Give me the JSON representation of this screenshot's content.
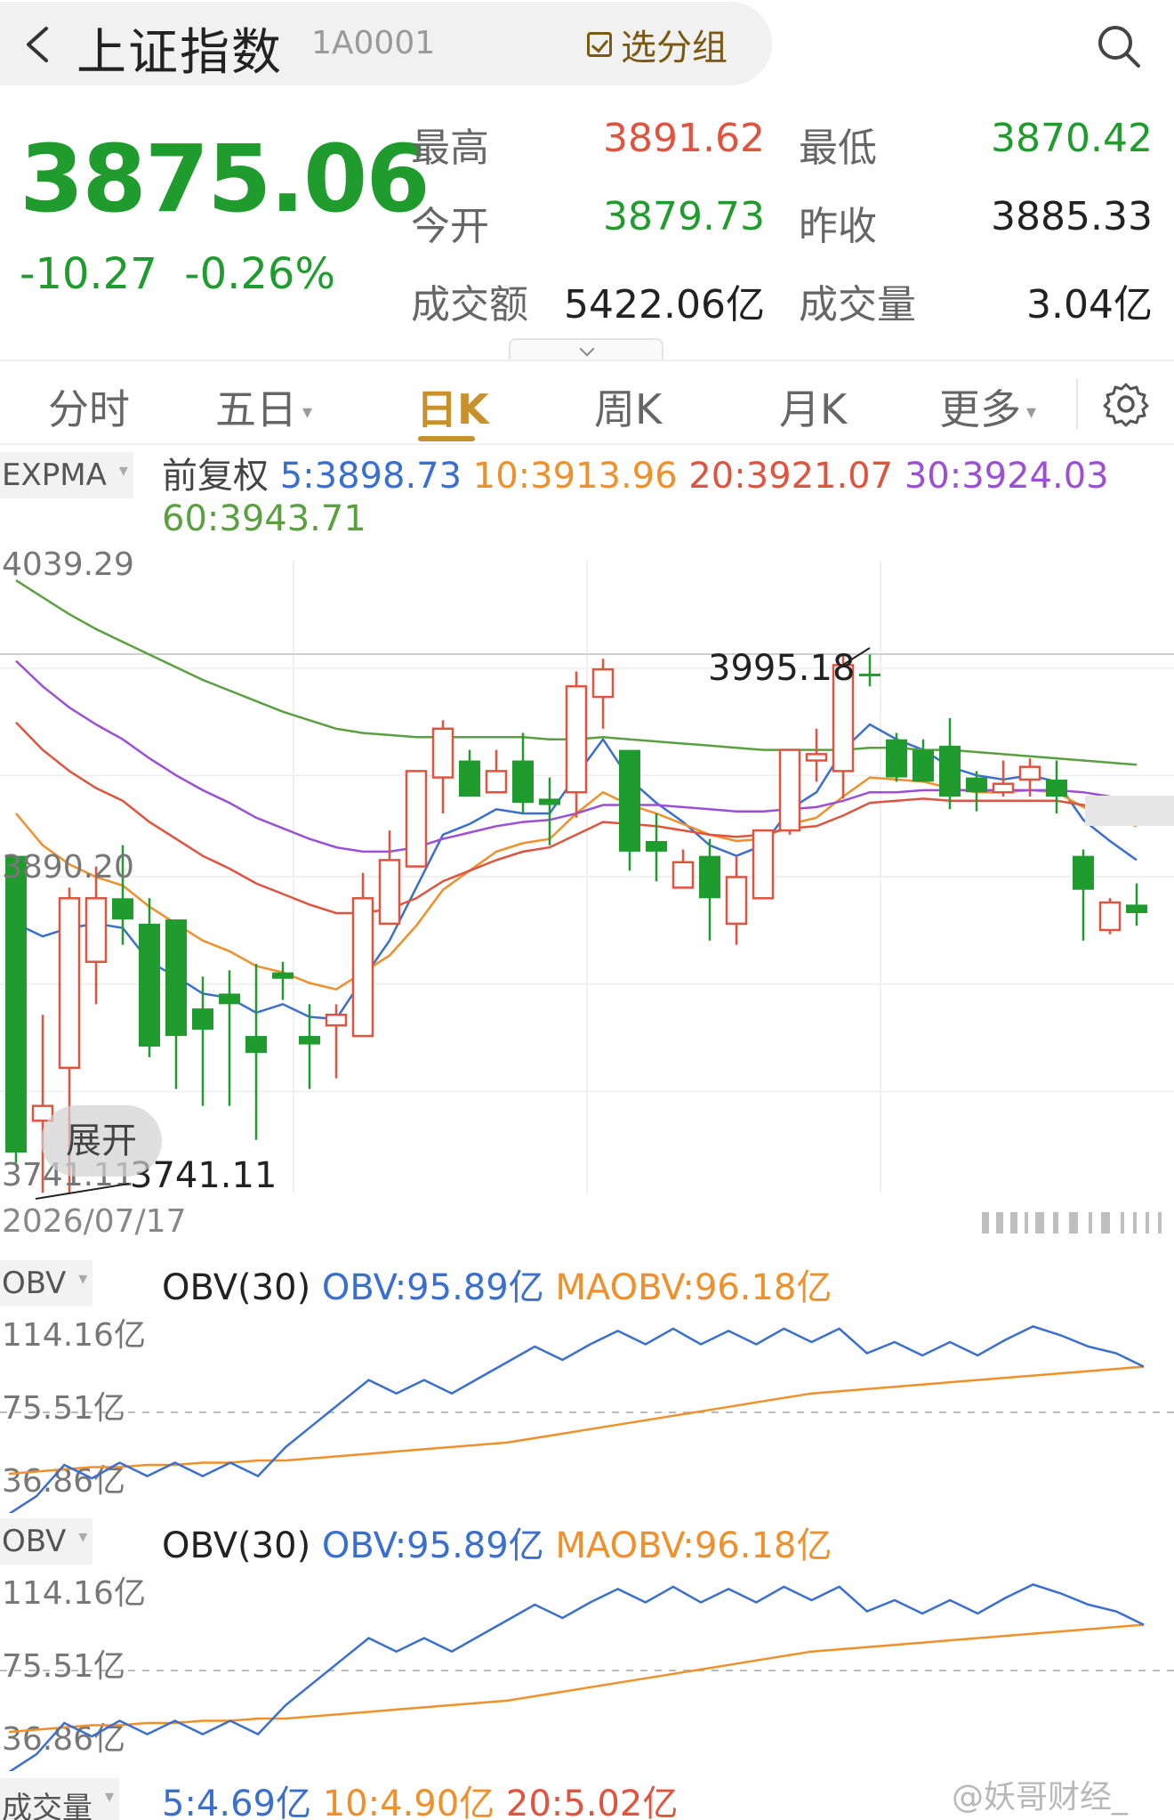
{
  "header": {
    "title": "上证指数",
    "code": "1A0001",
    "group_button": "选分组"
  },
  "quote": {
    "price": "3875.06",
    "change": "-10.27",
    "change_pct": "-0.26%",
    "stats": [
      {
        "label": "最高",
        "value": "3891.62",
        "color": "#e0533e"
      },
      {
        "label": "最低",
        "value": "3870.42",
        "color": "#1f9c2d"
      },
      {
        "label": "今开",
        "value": "3879.73",
        "color": "#1f9c2d"
      },
      {
        "label": "昨收",
        "value": "3885.33",
        "color": "#222222"
      },
      {
        "label": "成交额",
        "value": "5422.06亿",
        "color": "#222222"
      },
      {
        "label": "成交量",
        "value": "3.04亿",
        "color": "#222222"
      }
    ]
  },
  "tabs": [
    "分时",
    "五日",
    "日K",
    "周K",
    "月K",
    "更多"
  ],
  "active_tab": "日K",
  "kline": {
    "indicator": "EXPMA",
    "adjust": "前复权",
    "legend": [
      {
        "label": "5:3898.73",
        "color": "#3a6fd0"
      },
      {
        "label": "10:3913.96",
        "color": "#f0902a"
      },
      {
        "label": "20:3921.07",
        "color": "#e0533e"
      },
      {
        "label": "30:3924.03",
        "color": "#9b4fd6"
      },
      {
        "label": "60:3943.71",
        "color": "#5aa040"
      }
    ],
    "y_max_label": "4039.29",
    "y_mid_label": "3890.20",
    "y_min_label": "3741.11",
    "low_marker": "3741.11",
    "high_marker": "3995.18",
    "expand_label": "展开",
    "date": "2026/07/17"
  },
  "obv_panels": [
    {
      "indicator": "OBV",
      "params": "OBV(30)",
      "obv": "OBV:95.89亿",
      "maobv": "MAOBV:96.18亿",
      "y_labels": [
        "114.16亿",
        "75.51亿",
        "36.86亿"
      ]
    },
    {
      "indicator": "OBV",
      "params": "OBV(30)",
      "obv": "OBV:95.89亿",
      "maobv": "MAOBV:96.18亿",
      "y_labels": [
        "114.16亿",
        "75.51亿",
        "36.86亿"
      ]
    }
  ],
  "volume_row": {
    "indicator": "成交量",
    "ma5": "5:4.69亿",
    "ma10": "10:4.90亿",
    "ma20": "20:5.02亿"
  },
  "watermark": "@妖哥财经_",
  "colors": {
    "up": "#e0533e",
    "down": "#1f9c2d",
    "accent": "#c8912b",
    "obv": "#3a6fd0",
    "maobv": "#f0902a"
  },
  "chart_data": {
    "type": "candlestick",
    "ylim": [
      3741.11,
      4039.29
    ],
    "candles": [
      {
        "o": 3900,
        "h": 3900,
        "c": 3760,
        "l": 3755
      },
      {
        "o": 3775,
        "h": 3825,
        "c": 3782,
        "l": 3741
      },
      {
        "o": 3800,
        "h": 3885,
        "c": 3880,
        "l": 3741
      },
      {
        "o": 3850,
        "h": 3895,
        "c": 3880,
        "l": 3830
      },
      {
        "o": 3880,
        "h": 3905,
        "c": 3870,
        "l": 3858
      },
      {
        "o": 3868,
        "h": 3880,
        "c": 3810,
        "l": 3805
      },
      {
        "o": 3870,
        "h": 3870,
        "c": 3815,
        "l": 3790
      },
      {
        "o": 3828,
        "h": 3843,
        "c": 3818,
        "l": 3782
      },
      {
        "o": 3835,
        "h": 3846,
        "c": 3830,
        "l": 3782
      },
      {
        "o": 3815,
        "h": 3849,
        "c": 3807,
        "l": 3766
      },
      {
        "o": 3845,
        "h": 3850,
        "c": 3842,
        "l": 3832
      },
      {
        "o": 3815,
        "h": 3830,
        "c": 3811,
        "l": 3790
      },
      {
        "o": 3820,
        "h": 3830,
        "c": 3825,
        "l": 3795
      },
      {
        "o": 3815,
        "h": 3892,
        "c": 3880,
        "l": 3815
      },
      {
        "o": 3868,
        "h": 3912,
        "c": 3898,
        "l": 3868
      },
      {
        "o": 3895,
        "h": 3940,
        "c": 3940,
        "l": 3895
      },
      {
        "o": 3937,
        "h": 3964,
        "c": 3960,
        "l": 3920
      },
      {
        "o": 3945,
        "h": 3950,
        "c": 3928,
        "l": 3928
      },
      {
        "o": 3930,
        "h": 3950,
        "c": 3940,
        "l": 3930
      },
      {
        "o": 3945,
        "h": 3958,
        "c": 3925,
        "l": 3920
      },
      {
        "o": 3927,
        "h": 3937,
        "c": 3924,
        "l": 3905
      },
      {
        "o": 3930,
        "h": 3987,
        "c": 3980,
        "l": 3918
      },
      {
        "o": 3975,
        "h": 3993,
        "c": 3988,
        "l": 3960
      },
      {
        "o": 3950,
        "h": 3950,
        "c": 3902,
        "l": 3893
      },
      {
        "o": 3907,
        "h": 3920,
        "c": 3902,
        "l": 3888
      },
      {
        "o": 3885,
        "h": 3903,
        "c": 3897,
        "l": 3885
      },
      {
        "o": 3900,
        "h": 3908,
        "c": 3880,
        "l": 3860
      },
      {
        "o": 3868,
        "h": 3900,
        "c": 3890,
        "l": 3858
      },
      {
        "o": 3880,
        "h": 3910,
        "c": 3912,
        "l": 3880
      },
      {
        "o": 3912,
        "h": 3950,
        "c": 3950,
        "l": 3910
      },
      {
        "o": 3945,
        "h": 3960,
        "c": 3948,
        "l": 3935
      },
      {
        "o": 3940,
        "h": 3995,
        "c": 3990,
        "l": 3927
      },
      {
        "o": 3986,
        "h": 3995,
        "c": 3985,
        "l": 3980
      },
      {
        "o": 3955,
        "h": 3958,
        "c": 3937,
        "l": 3935
      },
      {
        "o": 3950,
        "h": 3955,
        "c": 3935,
        "l": 3935
      },
      {
        "o": 3952,
        "h": 3965,
        "c": 3928,
        "l": 3922
      },
      {
        "o": 3937,
        "h": 3940,
        "c": 3930,
        "l": 3921
      },
      {
        "o": 3930,
        "h": 3945,
        "c": 3934,
        "l": 3928
      },
      {
        "o": 3936,
        "h": 3946,
        "c": 3942,
        "l": 3928
      },
      {
        "o": 3936,
        "h": 3945,
        "c": 3928,
        "l": 3920
      },
      {
        "o": 3900,
        "h": 3903,
        "c": 3884,
        "l": 3860
      },
      {
        "o": 3865,
        "h": 3880,
        "c": 3878,
        "l": 3863
      },
      {
        "o": 3877,
        "h": 3887,
        "c": 3873,
        "l": 3867
      }
    ],
    "series": [
      {
        "name": "5",
        "values": [
          3868,
          3862,
          3866,
          3868,
          3866,
          3850,
          3843,
          3835,
          3833,
          3826,
          3830,
          3824,
          3823,
          3842,
          3860,
          3885,
          3910,
          3915,
          3922,
          3920,
          3920,
          3938,
          3955,
          3936,
          3925,
          3916,
          3905,
          3900,
          3905,
          3922,
          3930,
          3950,
          3962,
          3955,
          3950,
          3942,
          3938,
          3936,
          3938,
          3935,
          3917,
          3907,
          3898
        ]
      },
      {
        "name": "10",
        "values": [
          3920,
          3905,
          3896,
          3890,
          3886,
          3876,
          3868,
          3860,
          3855,
          3848,
          3845,
          3840,
          3837,
          3845,
          3853,
          3867,
          3884,
          3893,
          3902,
          3906,
          3908,
          3920,
          3930,
          3924,
          3920,
          3915,
          3910,
          3907,
          3908,
          3915,
          3918,
          3928,
          3937,
          3936,
          3935,
          3932,
          3930,
          3930,
          3931,
          3930,
          3923,
          3918,
          3914
        ]
      },
      {
        "name": "20",
        "values": [
          3963,
          3950,
          3940,
          3932,
          3926,
          3916,
          3908,
          3900,
          3894,
          3887,
          3882,
          3877,
          3873,
          3873,
          3875,
          3880,
          3888,
          3893,
          3898,
          3902,
          3904,
          3910,
          3916,
          3915,
          3914,
          3912,
          3910,
          3909,
          3910,
          3913,
          3914,
          3919,
          3925,
          3926,
          3927,
          3926,
          3926,
          3926,
          3926,
          3926,
          3924,
          3922,
          3921
        ]
      },
      {
        "name": "30",
        "values": [
          3992,
          3980,
          3970,
          3962,
          3955,
          3946,
          3938,
          3931,
          3925,
          3918,
          3913,
          3908,
          3904,
          3902,
          3902,
          3904,
          3908,
          3911,
          3914,
          3916,
          3917,
          3920,
          3924,
          3924,
          3924,
          3923,
          3922,
          3921,
          3921,
          3922,
          3923,
          3926,
          3930,
          3930,
          3931,
          3931,
          3931,
          3931,
          3931,
          3931,
          3930,
          3928,
          3924
        ]
      },
      {
        "name": "60",
        "values": [
          4030,
          4022,
          4014,
          4007,
          4001,
          3995,
          3989,
          3983,
          3978,
          3973,
          3968,
          3964,
          3960,
          3958,
          3957,
          3956,
          3956,
          3956,
          3956,
          3956,
          3955,
          3955,
          3956,
          3955,
          3954,
          3953,
          3952,
          3951,
          3950,
          3950,
          3950,
          3950,
          3951,
          3951,
          3950,
          3950,
          3949,
          3948,
          3947,
          3946,
          3945,
          3944,
          3943
        ]
      }
    ],
    "obv": {
      "ylim": [
        36.86,
        114.16
      ],
      "obv": [
        30,
        38,
        52,
        46,
        53,
        47,
        53,
        47,
        53,
        47,
        60,
        70,
        80,
        90,
        84,
        90,
        84,
        91,
        98,
        105,
        99,
        106,
        112,
        106,
        113,
        106,
        112,
        106,
        113,
        107,
        113,
        102,
        107,
        101,
        107,
        101,
        108,
        114,
        110,
        105,
        102,
        96
      ],
      "maobv": [
        48,
        49,
        50,
        51,
        51,
        52,
        52,
        53,
        53,
        54,
        54,
        55,
        56,
        57,
        58,
        59,
        60,
        61,
        62,
        64,
        66,
        68,
        70,
        72,
        74,
        76,
        78,
        80,
        82,
        84,
        85,
        86,
        87,
        88,
        89,
        90,
        91,
        92,
        93,
        94,
        95,
        96
      ]
    }
  }
}
